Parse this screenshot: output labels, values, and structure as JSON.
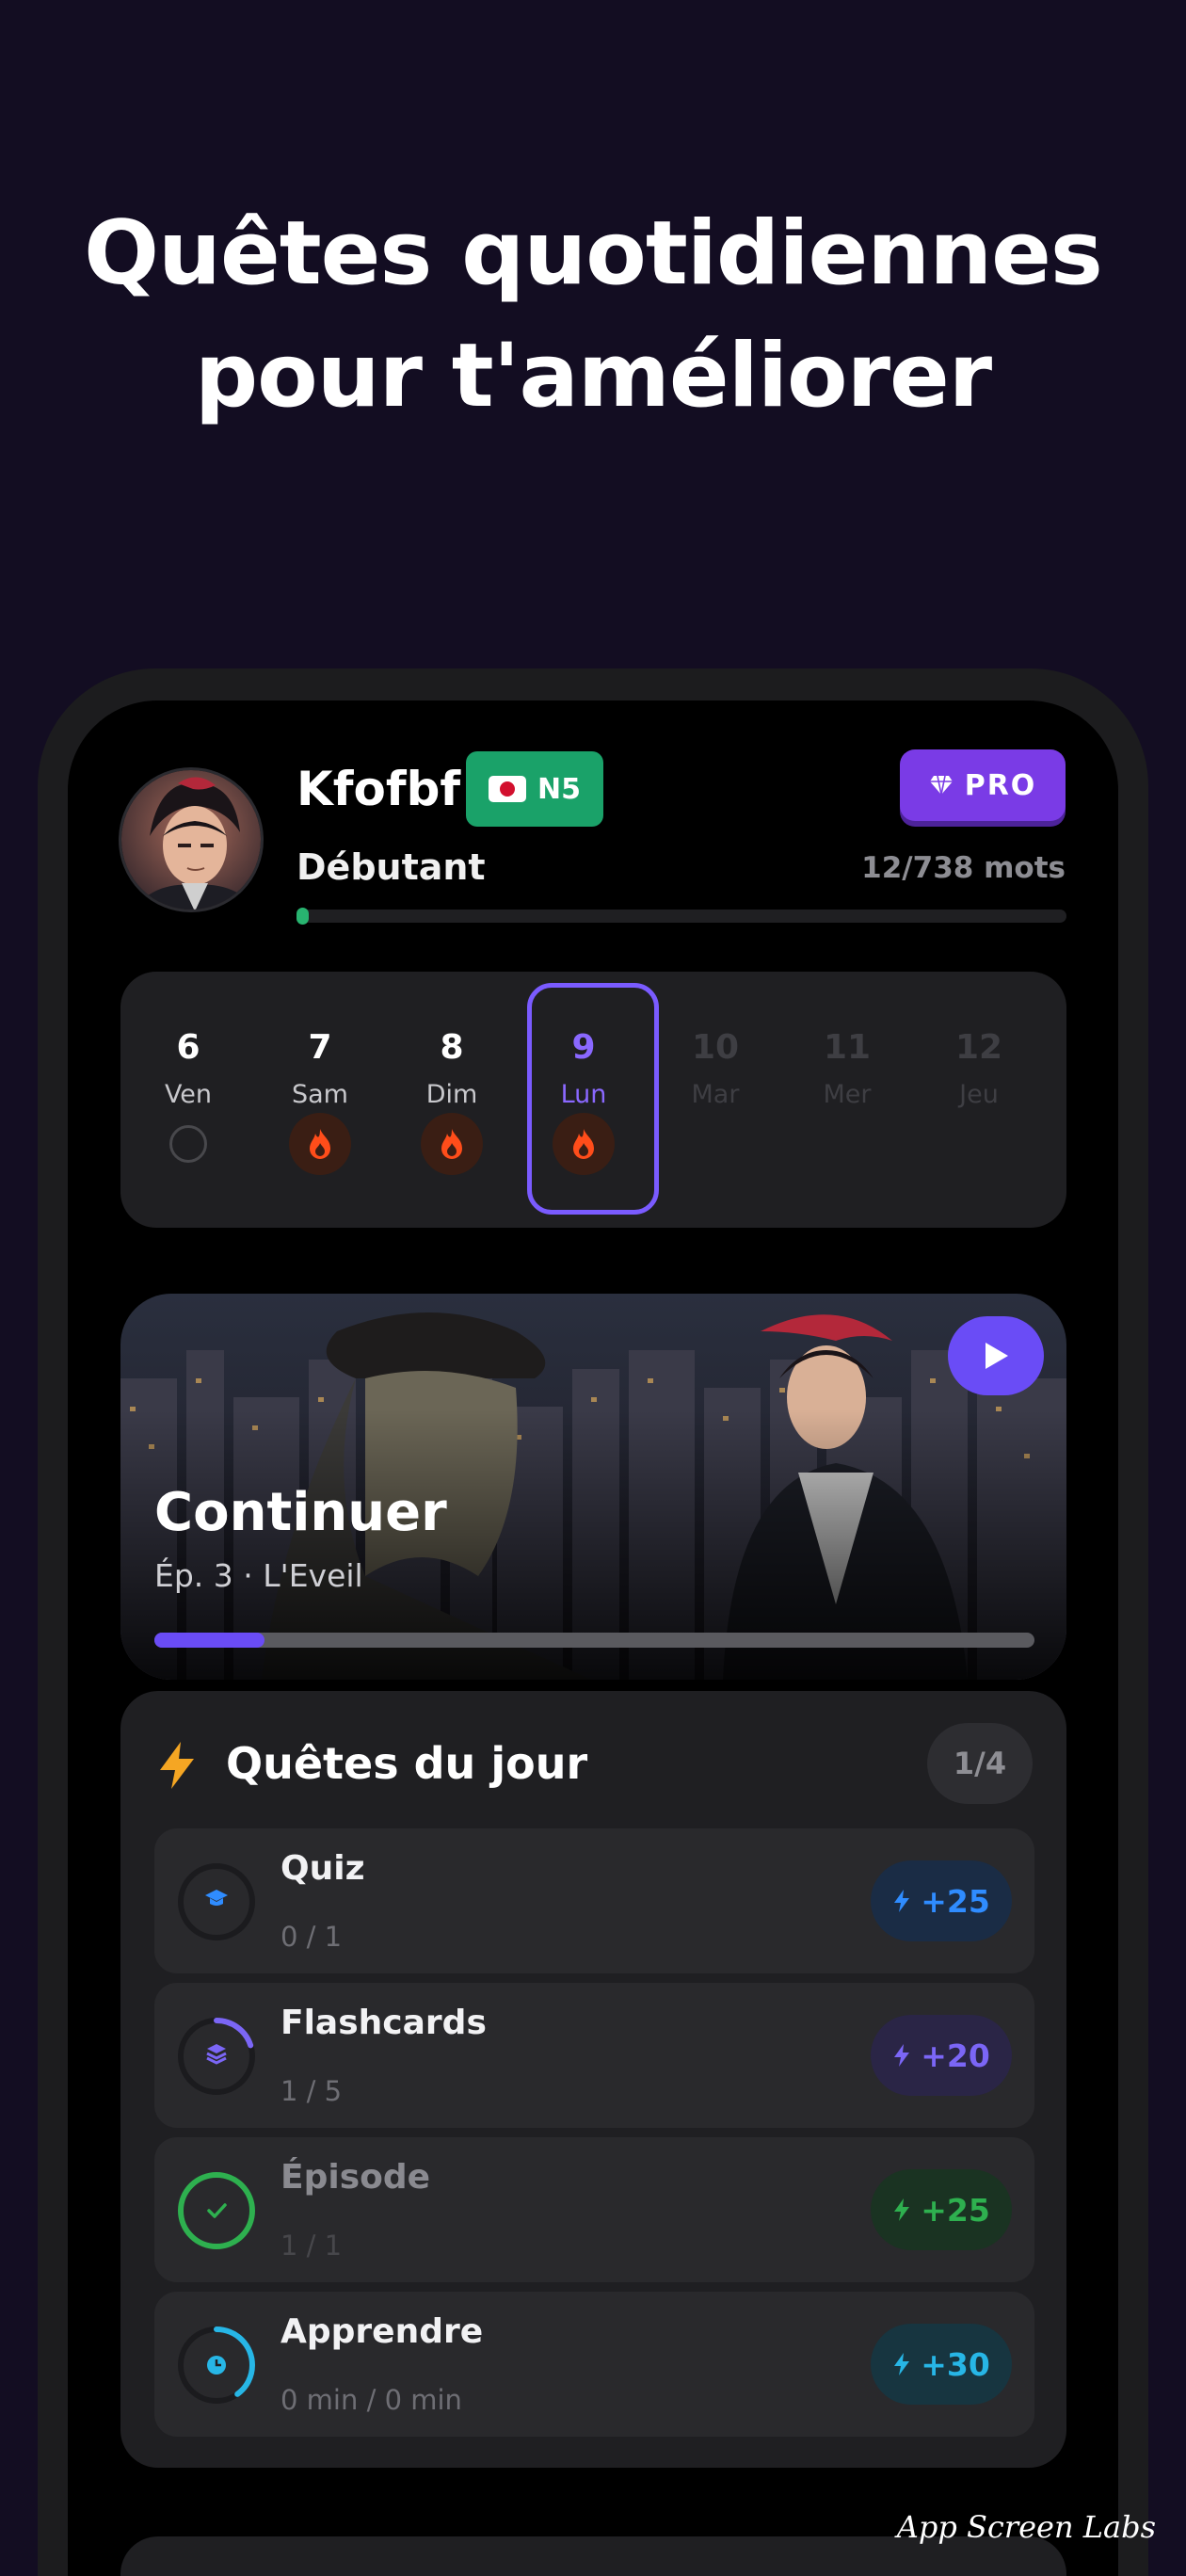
{
  "headline": {
    "line1": "Quêtes quotidiennes",
    "line2": "pour t'améliorer"
  },
  "profile": {
    "username": "Kfofbf",
    "jlpt_level": "N5",
    "pro_label": "PRO",
    "level_title": "Débutant",
    "word_count": "12/738 mots",
    "word_progress": 0.016
  },
  "week": [
    {
      "num": "6",
      "name": "Ven",
      "state": "missed"
    },
    {
      "num": "7",
      "name": "Sam",
      "state": "streak"
    },
    {
      "num": "8",
      "name": "Dim",
      "state": "streak"
    },
    {
      "num": "9",
      "name": "Lun",
      "state": "today"
    },
    {
      "num": "10",
      "name": "Mar",
      "state": "future"
    },
    {
      "num": "11",
      "name": "Mer",
      "state": "future"
    },
    {
      "num": "12",
      "name": "Jeu",
      "state": "future"
    }
  ],
  "continue_card": {
    "title": "Continuer",
    "subtitle": "Ép. 3 · L'Eveil",
    "progress": 0.125
  },
  "quests": {
    "title": "Quêtes du jour",
    "count": "1/4",
    "items": [
      {
        "name": "Quiz",
        "progress": "0 / 1",
        "xp": "+25",
        "icon": "graduation-cap-icon",
        "color": "#2f8cff",
        "ratio": 0
      },
      {
        "name": "Flashcards",
        "progress": "1 / 5",
        "xp": "+20",
        "icon": "stack-icon",
        "color": "#7b66f6",
        "ratio": 0.2
      },
      {
        "name": "Épisode",
        "progress": "1 / 1",
        "xp": "+25",
        "icon": "check-icon",
        "color": "#2eb04f",
        "ratio": 1
      },
      {
        "name": "Apprendre",
        "progress": "0 min / 0 min",
        "xp": "+30",
        "icon": "clock-icon",
        "color": "#27b6e6",
        "ratio": 0.4
      }
    ]
  },
  "watermark": "App Screen Labs"
}
